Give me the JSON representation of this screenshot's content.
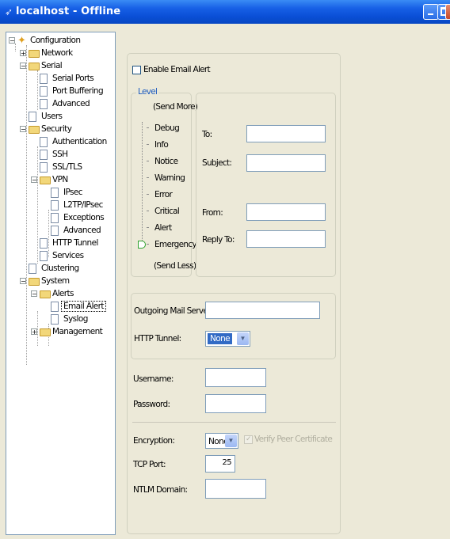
{
  "window": {
    "title": "localhost - Offline"
  },
  "tree": {
    "items": [
      {
        "label": "Configuration"
      },
      {
        "label": "Network"
      },
      {
        "label": "Serial"
      },
      {
        "label": "Serial Ports"
      },
      {
        "label": "Port Buffering"
      },
      {
        "label": "Advanced"
      },
      {
        "label": "Users"
      },
      {
        "label": "Security"
      },
      {
        "label": "Authentication"
      },
      {
        "label": "SSH"
      },
      {
        "label": "SSL/TLS"
      },
      {
        "label": "VPN"
      },
      {
        "label": "IPsec"
      },
      {
        "label": "L2TP/IPsec"
      },
      {
        "label": "Exceptions"
      },
      {
        "label": "Advanced"
      },
      {
        "label": "HTTP Tunnel"
      },
      {
        "label": "Services"
      },
      {
        "label": "Clustering"
      },
      {
        "label": "System"
      },
      {
        "label": "Alerts"
      },
      {
        "label": "Email Alert"
      },
      {
        "label": "Syslog"
      },
      {
        "label": "Management"
      }
    ],
    "selected": "Email Alert"
  },
  "form": {
    "enable_email_alert": {
      "label": "Enable Email Alert",
      "checked": false
    },
    "level": {
      "title": "Level",
      "send_more": "(Send More)",
      "send_less": "(Send Less)",
      "levels": [
        "Debug",
        "Info",
        "Notice",
        "Warning",
        "Error",
        "Critical",
        "Alert",
        "Emergency"
      ],
      "selected": "Emergency"
    },
    "to": {
      "label": "To:",
      "value": ""
    },
    "subject": {
      "label": "Subject:",
      "value": ""
    },
    "from": {
      "label": "From:",
      "value": ""
    },
    "reply_to": {
      "label": "Reply To:",
      "value": ""
    },
    "smtp": {
      "label": "Outgoing Mail Server (SMTP):",
      "value": ""
    },
    "http_tunnel": {
      "label": "HTTP Tunnel:",
      "value": "None"
    },
    "username": {
      "label": "Username:",
      "value": ""
    },
    "password": {
      "label": "Password:",
      "value": ""
    },
    "encryption": {
      "label": "Encryption:",
      "value": "None"
    },
    "verify_peer": {
      "label": "Verify Peer Certificate",
      "checked": true,
      "enabled": false
    },
    "tcp_port": {
      "label": "TCP Port:",
      "value": "25"
    },
    "ntlm_domain": {
      "label": "NTLM Domain:",
      "value": ""
    }
  },
  "icons": {
    "window": "app-icon",
    "tree_expand": "expand-box-icon",
    "folder": "folder-icon",
    "page": "page-icon",
    "config": "configuration-icon",
    "dropdown": "chevron-down-icon"
  }
}
